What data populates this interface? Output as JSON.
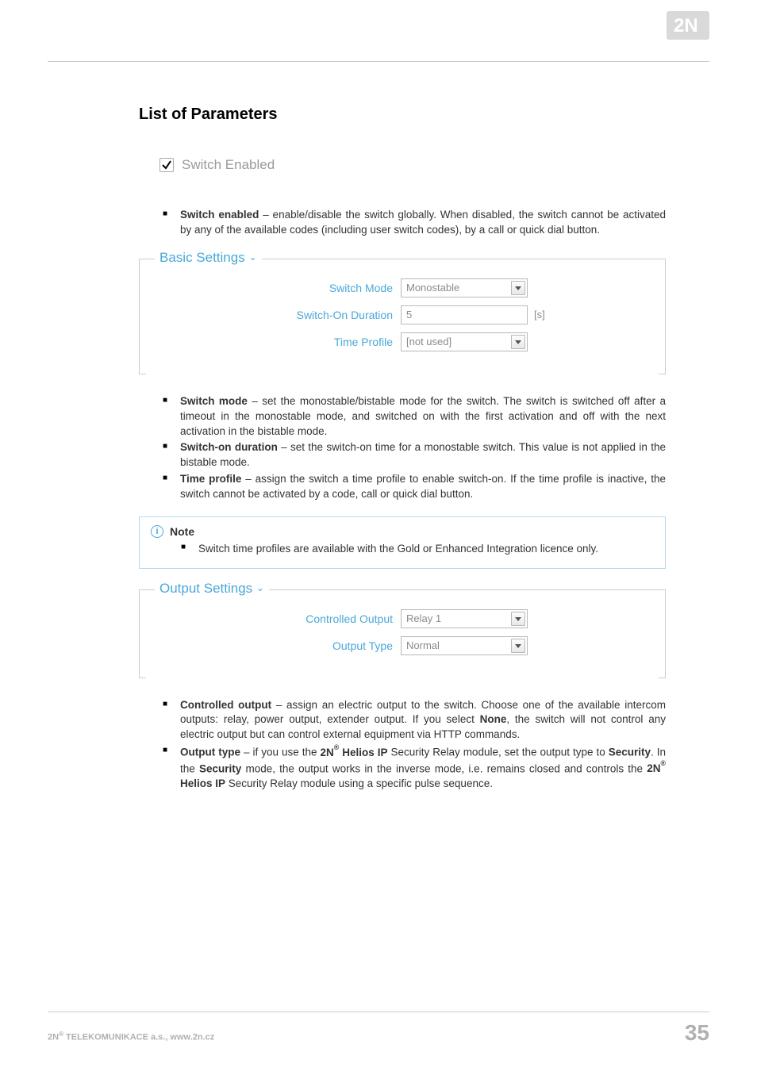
{
  "heading": "List of Parameters",
  "switch_enabled": {
    "label": "Switch Enabled",
    "checked": true
  },
  "bullets1": [
    {
      "term": "Switch enabled",
      "desc": " – enable/disable the switch globally. When disabled, the switch cannot be activated by any of the available codes (including user switch codes), by a call or quick dial button."
    }
  ],
  "basic_settings": {
    "title": "Basic Settings",
    "switch_mode": {
      "label": "Switch Mode",
      "value": "Monostable"
    },
    "switch_on_duration": {
      "label": "Switch-On Duration",
      "value": "5",
      "unit": "[s]"
    },
    "time_profile": {
      "label": "Time Profile",
      "value": "[not used]"
    }
  },
  "bullets2": [
    {
      "term": "Switch mode",
      "desc": " – set the monostable/bistable mode for the switch. The switch is switched off after a timeout in the monostable mode, and switched on with the first activation and off with the next activation in the bistable mode."
    },
    {
      "term": "Switch-on duration",
      "desc": " – set the switch-on time for a monostable switch. This value is not applied in the bistable mode."
    },
    {
      "term": "Time profile",
      "desc": " – assign the switch a time profile to enable switch-on. If the time profile is inactive, the switch cannot be activated by a code, call or quick dial button."
    }
  ],
  "note": {
    "title": "Note",
    "text": "Switch time profiles are available with the Gold or Enhanced Integration licence only."
  },
  "output_settings": {
    "title": "Output Settings",
    "controlled_output": {
      "label": "Controlled Output",
      "value": "Relay 1"
    },
    "output_type": {
      "label": "Output Type",
      "value": "Normal"
    }
  },
  "bullets3": {
    "controlled_output": {
      "term": "Controlled output",
      "p1": " – assign an electric output to the switch. Choose one of the available intercom outputs: relay, power output, extender output. If you select ",
      "none": "None",
      "p2": ", the switch will not control any electric output but can control external equipment via HTTP commands."
    },
    "output_type": {
      "term": "Output type",
      "p1": " – if you use the ",
      "brand1a": "2N",
      "brand1b": " Helios IP",
      "p2": " Security Relay module, set the output type to ",
      "security1": "Security",
      "p3": ". In the ",
      "security2": "Security",
      "p4": " mode, the output works in the inverse mode, i.e. remains closed and controls the ",
      "brand2a": "2N",
      "brand2b": " Helios IP",
      "p5": " Security Relay module using a specific pulse sequence."
    }
  },
  "footer": {
    "company_a": "2N",
    "company_b": " TELEKOMUNIKACE a.s., www.2n.cz",
    "page": "35"
  },
  "chart_data": {
    "type": "table",
    "title": "Form field values shown in screenshot",
    "rows": [
      {
        "section": "Switch Enabled",
        "field": "Switch Enabled",
        "value": "checked"
      },
      {
        "section": "Basic Settings",
        "field": "Switch Mode",
        "value": "Monostable"
      },
      {
        "section": "Basic Settings",
        "field": "Switch-On Duration",
        "value": "5",
        "unit": "s"
      },
      {
        "section": "Basic Settings",
        "field": "Time Profile",
        "value": "[not used]"
      },
      {
        "section": "Output Settings",
        "field": "Controlled Output",
        "value": "Relay 1"
      },
      {
        "section": "Output Settings",
        "field": "Output Type",
        "value": "Normal"
      }
    ]
  }
}
